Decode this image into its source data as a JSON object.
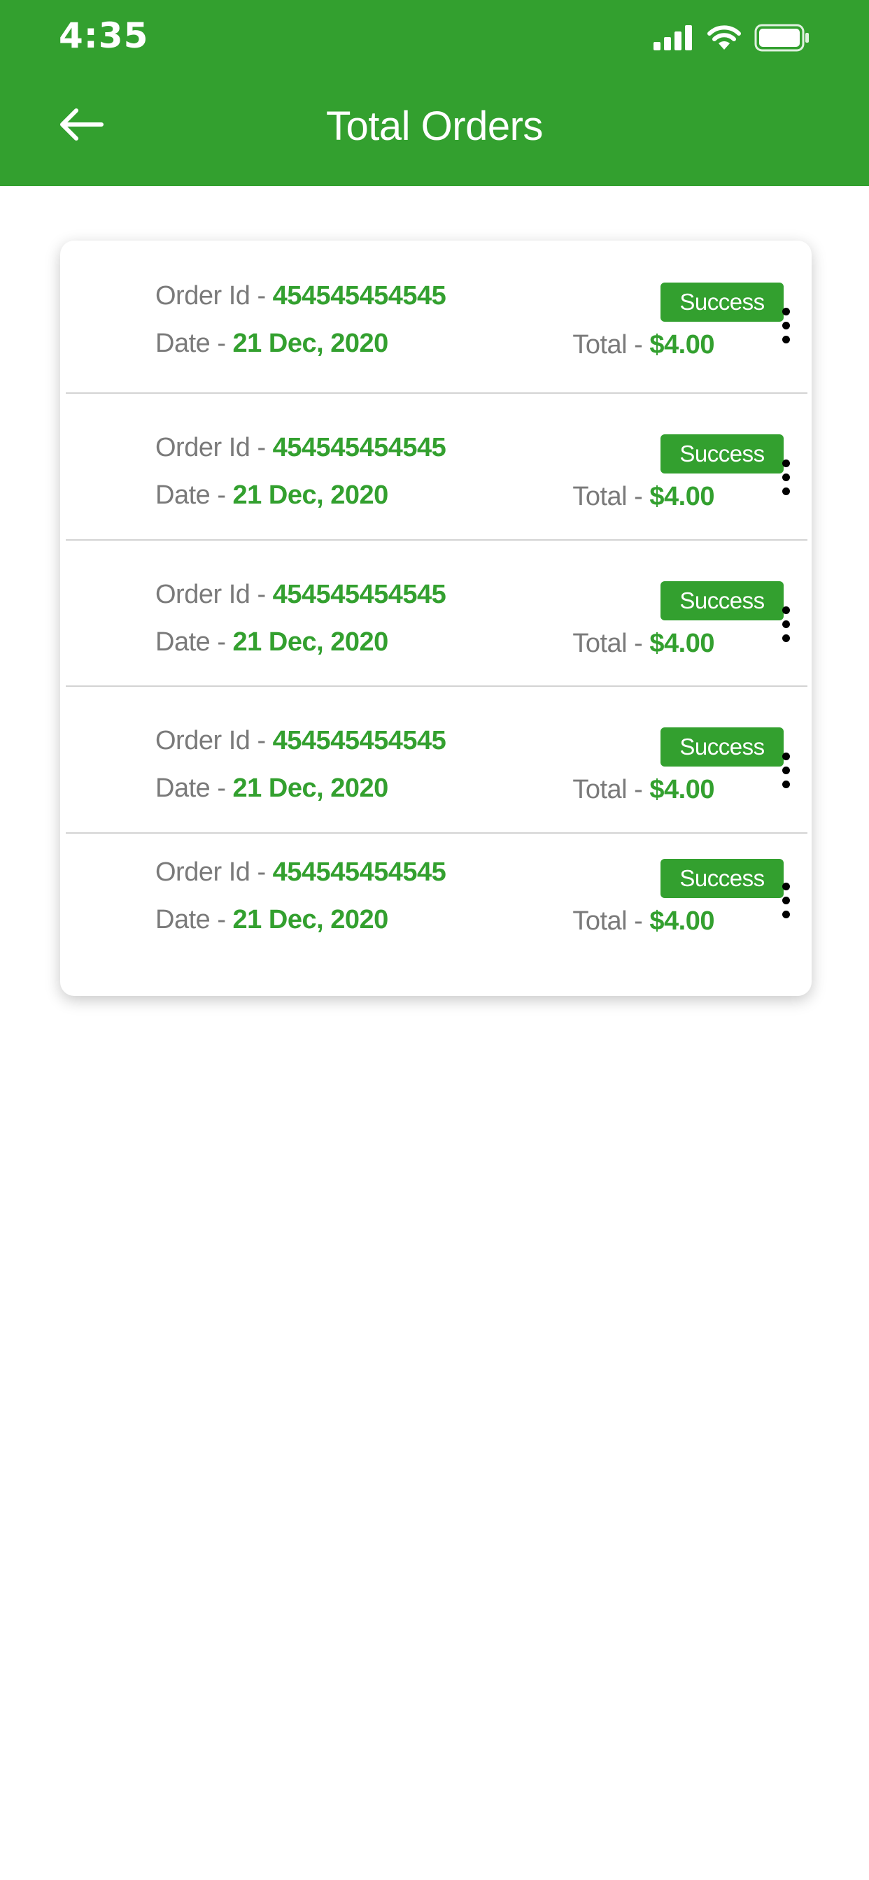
{
  "status_bar": {
    "time": "4:35",
    "icons": [
      "signal-icon",
      "wifi-icon",
      "battery-icon"
    ]
  },
  "header": {
    "title": "Total Orders",
    "back_icon": "arrow-left-icon"
  },
  "colors": {
    "accent": "#33a02f",
    "muted_text": "#7a7a7a",
    "divider": "#d3d3d3"
  },
  "orders": [
    {
      "order_label": "Order Id - ",
      "order_id": "454545454545",
      "date_label": "Date - ",
      "date": "21 Dec, 2020",
      "status": "Success",
      "total_label": "Total - ",
      "total": "$4.00",
      "menu_icon": "more-vertical-icon"
    },
    {
      "order_label": "Order Id - ",
      "order_id": "454545454545",
      "date_label": "Date - ",
      "date": "21 Dec, 2020",
      "status": "Success",
      "total_label": "Total - ",
      "total": "$4.00",
      "menu_icon": "more-vertical-icon"
    },
    {
      "order_label": "Order Id - ",
      "order_id": "454545454545",
      "date_label": "Date - ",
      "date": "21 Dec, 2020",
      "status": "Success",
      "total_label": "Total - ",
      "total": "$4.00",
      "menu_icon": "more-vertical-icon"
    },
    {
      "order_label": "Order Id - ",
      "order_id": "454545454545",
      "date_label": "Date - ",
      "date": "21 Dec, 2020",
      "status": "Success",
      "total_label": "Total - ",
      "total": "$4.00",
      "menu_icon": "more-vertical-icon"
    },
    {
      "order_label": "Order Id - ",
      "order_id": "454545454545",
      "date_label": "Date - ",
      "date": "21 Dec, 2020",
      "status": "Success",
      "total_label": "Total - ",
      "total": "$4.00",
      "menu_icon": "more-vertical-icon"
    }
  ]
}
